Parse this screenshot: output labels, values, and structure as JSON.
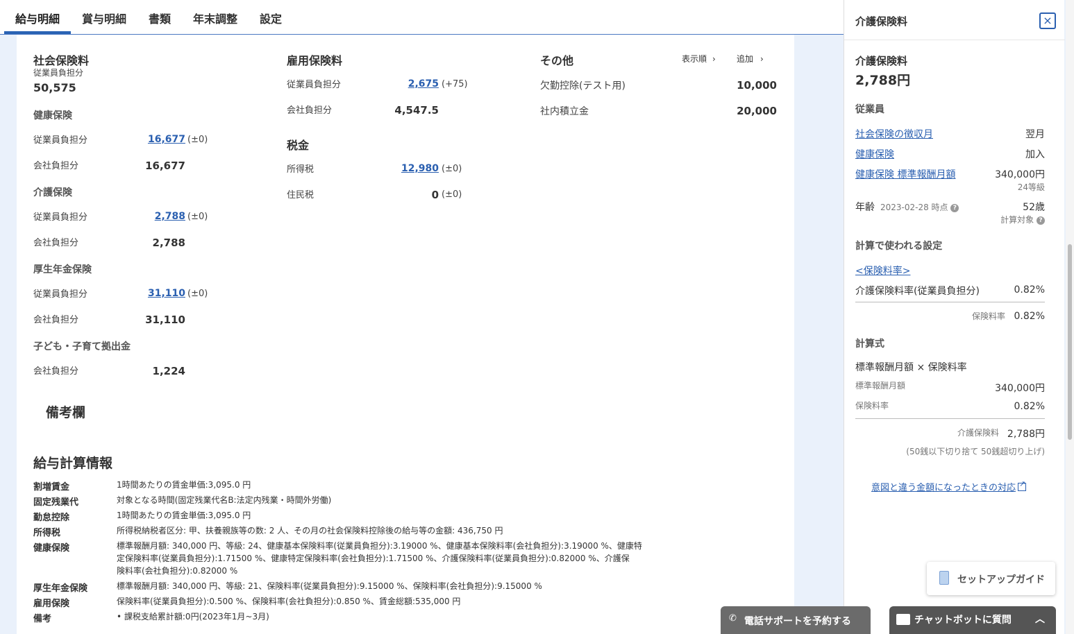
{
  "tabs": [
    "給与明細",
    "賞与明細",
    "書類",
    "年末調整",
    "設定"
  ],
  "social": {
    "title": "社会保険料",
    "emp_label": "従業員負担分",
    "total": "50,575",
    "health": {
      "title": "健康保険",
      "emp_label": "従業員負担分",
      "emp": "16,677",
      "emp_diff": "(±0)",
      "co_label": "会社負担分",
      "co": "16,677"
    },
    "care": {
      "title": "介護保険",
      "emp_label": "従業員負担分",
      "emp": "2,788",
      "emp_diff": "(±0)",
      "co_label": "会社負担分",
      "co": "2,788"
    },
    "pension": {
      "title": "厚生年金保険",
      "emp_label": "従業員負担分",
      "emp": "31,110",
      "emp_diff": "(±0)",
      "co_label": "会社負担分",
      "co": "31,110"
    },
    "child": {
      "title": "子ども・子育て拠出金",
      "co_label": "会社負担分",
      "co": "1,224"
    }
  },
  "employment": {
    "title": "雇用保険料",
    "emp_label": "従業員負担分",
    "emp": "2,675",
    "emp_diff": "(+75)",
    "co_label": "会社負担分",
    "co": "4,547.5"
  },
  "tax": {
    "title": "税金",
    "income_label": "所得税",
    "income": "12,980",
    "income_diff": "(±0)",
    "resident_label": "住民税",
    "resident": "0",
    "resident_diff": "(±0)"
  },
  "other": {
    "title": "その他",
    "order_btn": "表示順",
    "add_btn": "追加",
    "items": [
      {
        "label": "欠勤控除(テスト用)",
        "value": "10,000"
      },
      {
        "label": "社内積立金",
        "value": "20,000"
      }
    ]
  },
  "remarks": {
    "title": "備考欄"
  },
  "calc_info": {
    "title": "給与計算情報",
    "rows": [
      {
        "key": "割増賃金",
        "lines": [
          "1時間あたりの賃金単価:3,095.0 円"
        ]
      },
      {
        "key": "固定残業代",
        "lines": [
          "対象となる時間(固定残業代名B:法定内残業・時間外労働)"
        ]
      },
      {
        "key": "勤怠控除",
        "lines": [
          "1時間あたりの賃金単価:3,095.0 円"
        ]
      },
      {
        "key": "所得税",
        "lines": [
          "所得税納税者区分: 甲、扶養親族等の数: 2 人、その月の社会保険料控除後の給与等の金額: 436,750 円"
        ]
      },
      {
        "key": "健康保険",
        "lines": [
          "標準報酬月額: 340,000 円、等級: 24、健康基本保険料率(従業員負担分):3.19000 %、健康基本保険料率(会社負担分):3.19000 %、健康特",
          "定保険料率(従業員負担分):1.71500 %、健康特定保険料率(会社負担分):1.71500 %、介護保険料率(従業員負担分):0.82000 %、介護保",
          "険料率(会社負担分):0.82000 %"
        ]
      },
      {
        "key": "厚生年金保険",
        "lines": [
          "標準報酬月額: 340,000 円、等級: 21、保険料率(従業員負担分):9.15000 %、保険料率(会社負担分):9.15000 %"
        ]
      },
      {
        "key": "雇用保険",
        "lines": [
          "保険料率(従業員負担分):0.500 %、保険料率(会社負担分):0.850 %、賃金総額:535,000 円"
        ]
      },
      {
        "key": "備考",
        "lines": [
          "•  課税支給累計額:0円(2023年1月~3月)"
        ]
      }
    ]
  },
  "panel": {
    "header": "介護保険料",
    "title": "介護保険料",
    "amount": "2,788円",
    "employee_heading": "従業員",
    "rows": [
      {
        "label": "社会保険の徴収月",
        "value": "翌月"
      },
      {
        "label": "健康保険",
        "value": "加入"
      },
      {
        "label": "健康保険 標準報酬月額",
        "value": "340,000円",
        "sub": "24等級"
      }
    ],
    "age_label": "年齢",
    "age_date": "2023-02-28 時点",
    "age_value": "52歳",
    "age_sub": "計算対象",
    "settings_heading": "計算で使われる設定",
    "rate_link": "<保険料率>",
    "rate_label": "介護保険料率(従業員負担分)",
    "rate_value": "0.82%",
    "rate_total_label": "保険料率",
    "rate_total_value": "0.82%",
    "formula_heading": "計算式",
    "formula": "標準報酬月額 × 保険料率",
    "f1_label": "標準報酬月額",
    "f1_value": "340,000円",
    "f2_label": "保険料率",
    "f2_value": "0.82%",
    "result_label": "介護保険料",
    "result_value": "2,788円",
    "rounding": "(50銭以下切り捨て 50銭超切り上げ)",
    "help_link": "意図と違う金額になったときの対応"
  },
  "setup_guide": "セットアップガイド",
  "phone_support": "電話サポートを予約する",
  "chatbot": "チャットボットに質問"
}
